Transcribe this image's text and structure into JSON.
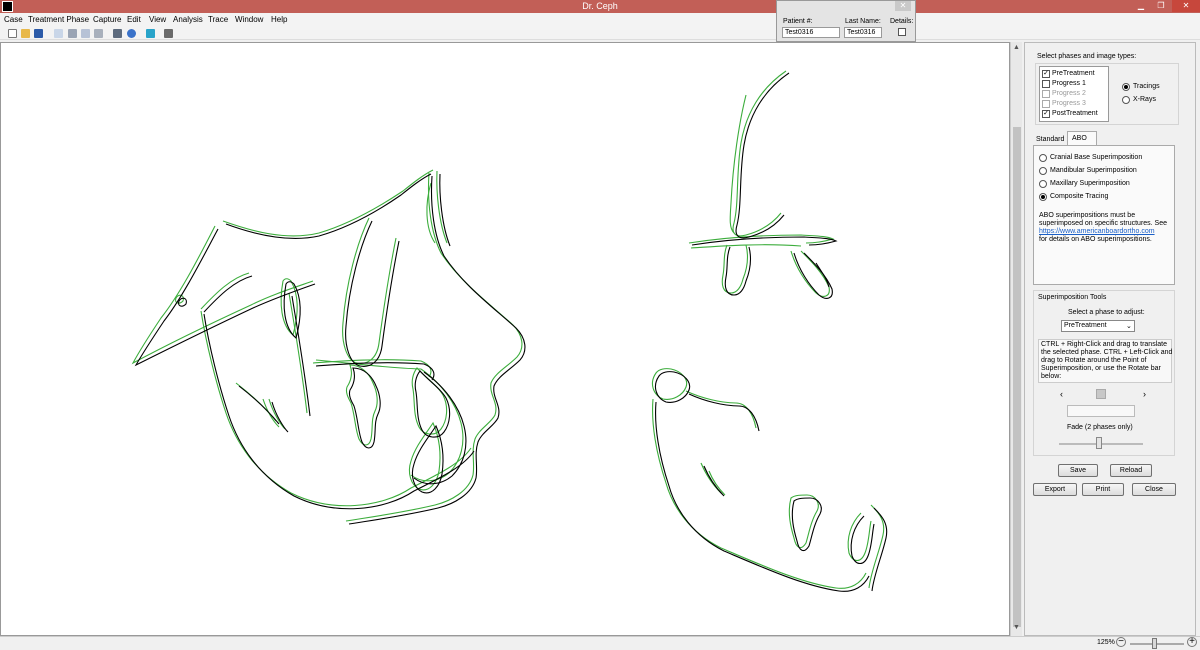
{
  "window": {
    "title": "Dr. Ceph",
    "min_icon": "minimize-icon",
    "max_icon": "maximize-icon",
    "close_label": "✕"
  },
  "menu": [
    "Case",
    "Treatment Phase",
    "Capture",
    "Edit",
    "View",
    "Analysis",
    "Trace",
    "Window",
    "Help"
  ],
  "toolbar_icons": [
    "new-file-icon",
    "open-folder-icon",
    "save-icon",
    "copy-doc-icon",
    "cut-icon",
    "copy-icon",
    "paste-icon",
    "print-icon",
    "help-icon",
    "capture-icon",
    "analysis-icon"
  ],
  "patient": {
    "id_label": "Patient #:",
    "lastname_label": "Last Name:",
    "details_label": "Details:",
    "id_value": "Test0316",
    "lastname_value": "Test0316",
    "close_label": "✕"
  },
  "panel": {
    "phases_label": "Select phases and image types:",
    "phases": [
      {
        "label": "PreTreatment",
        "checked": true,
        "enabled": true
      },
      {
        "label": "Progress 1",
        "checked": false,
        "enabled": true
      },
      {
        "label": "Progress 2",
        "checked": false,
        "enabled": false
      },
      {
        "label": "Progress 3",
        "checked": false,
        "enabled": false
      },
      {
        "label": "PostTreatment",
        "checked": true,
        "enabled": true
      }
    ],
    "image_types": [
      {
        "label": "Tracings",
        "selected": true
      },
      {
        "label": "X-Rays",
        "selected": false
      }
    ],
    "tabs": [
      {
        "label": "Standard",
        "active": false
      },
      {
        "label": "ABO",
        "active": true
      }
    ],
    "abo_options": [
      {
        "label": "Cranial Base Superimposition",
        "selected": false
      },
      {
        "label": "Mandibular Superimposition",
        "selected": false
      },
      {
        "label": "Maxillary Superimposition",
        "selected": false
      },
      {
        "label": "Composite Tracing",
        "selected": true
      }
    ],
    "abo_note_1": "ABO superimpositions must be",
    "abo_note_2": "superimposed on specific structures. See",
    "abo_link": "https://www.americanboardortho.com",
    "abo_note_3": "for details on ABO superimpositions.",
    "tools_label": "Superimposition Tools",
    "select_phase_label": "Select a phase to adjust:",
    "phase_dropdown": "PreTreatment",
    "instructions": [
      "CTRL + Right-Click and drag to translate",
      "the selected phase. CTRL + Left-Click and",
      "drag to Rotate around the Point of",
      "Superimposition, or use the Rotate bar",
      "below:"
    ],
    "rotate_left": "‹",
    "rotate_right": "›",
    "fade_label": "Fade (2 phases only)",
    "buttons": {
      "save": "Save",
      "reload": "Reload",
      "export": "Export",
      "print": "Print",
      "close": "Close"
    }
  },
  "status": {
    "zoom": "125%",
    "zoom_out": "−",
    "zoom_in": "+"
  },
  "colors": {
    "pre_tracing": "#000000",
    "post_tracing": "#3cad3c",
    "titlebar": "#c25f57",
    "link": "#1a5fc7"
  }
}
